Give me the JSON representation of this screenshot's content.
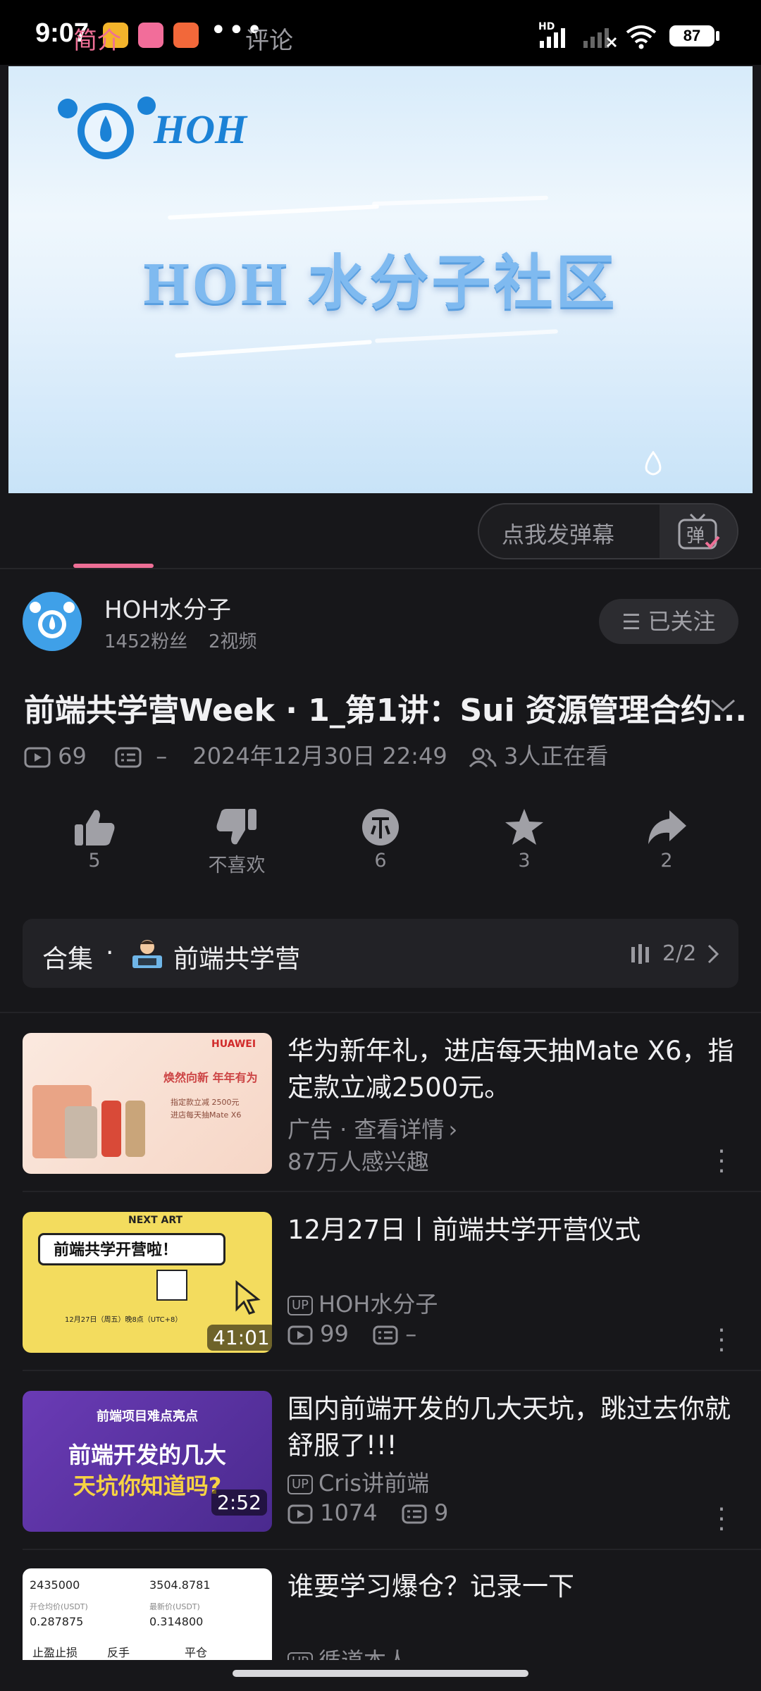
{
  "status_bar": {
    "time": "9:07",
    "battery": "87",
    "dots": "•••",
    "network": "HD"
  },
  "player": {
    "logo_text": "HOH",
    "title": "HOH 水分子社区"
  },
  "tabs": {
    "intro": "简介",
    "comments": "评论",
    "danmaku_placeholder": "点我发弹幕",
    "danmaku_icon": "弹"
  },
  "uploader": {
    "name": "HOH水分子",
    "fans": "1452粉丝",
    "videos": "2视频",
    "follow_label": "已关注"
  },
  "video": {
    "title": "前端共学营Week · 1_第1讲：Sui 资源管理合约...",
    "plays": "69",
    "danmaku_count": "–",
    "date": "2024年12月30日 22:49",
    "watching": "3人正在看"
  },
  "actions": {
    "like": "5",
    "dislike": "不喜欢",
    "coin": "6",
    "favorite": "3",
    "share": "2"
  },
  "collection": {
    "label": "合集",
    "dot": "·",
    "name": "前端共学营",
    "progress": "2/2"
  },
  "feed": [
    {
      "title": "华为新年礼，进店每天抽Mate X6，指定款立减2500元。",
      "line1": "广告 · 查看详情",
      "line2": "87万人感兴趣",
      "thumb_brand": "HUAWEI",
      "thumb_text1": "焕然向新 年年有为",
      "thumb_text2": "指定款立减 2500元",
      "thumb_text3": "进店每天抽Mate X6"
    },
    {
      "title": "12月27日丨前端共学开营仪式",
      "author": "HOH水分子",
      "plays": "99",
      "danmaku": "–",
      "duration": "41:01",
      "thumb_tag": "NEXT ART",
      "thumb_text": "前端共学开营啦！",
      "thumb_date": "12月27日（周五）晚8点（UTC+8）"
    },
    {
      "title": "国内前端开发的几大天坑，跳过去你就舒服了!!!",
      "author": "Cris讲前端",
      "plays": "1074",
      "danmaku": "9",
      "duration": "2:52",
      "thumb_head": "前端项目难点亮点",
      "thumb_line1": "前端开发的几大",
      "thumb_line2": "天坑你知道吗?"
    },
    {
      "title": "谁要学习爆仓？记录一下",
      "author": "循道本人",
      "thumb_v1": "2435000",
      "thumb_v2": "3504.8781",
      "thumb_l1": "开仓均价(USDT)",
      "thumb_l2": "最新价(USDT)",
      "thumb_v3": "0.287875",
      "thumb_v4": "0.314800",
      "thumb_b1": "止盈止损",
      "thumb_b2": "反手",
      "thumb_b3": "平仓"
    }
  ],
  "up_tag": "UP",
  "colors": {
    "accent": "#ee6f96",
    "background": "#17171a"
  }
}
